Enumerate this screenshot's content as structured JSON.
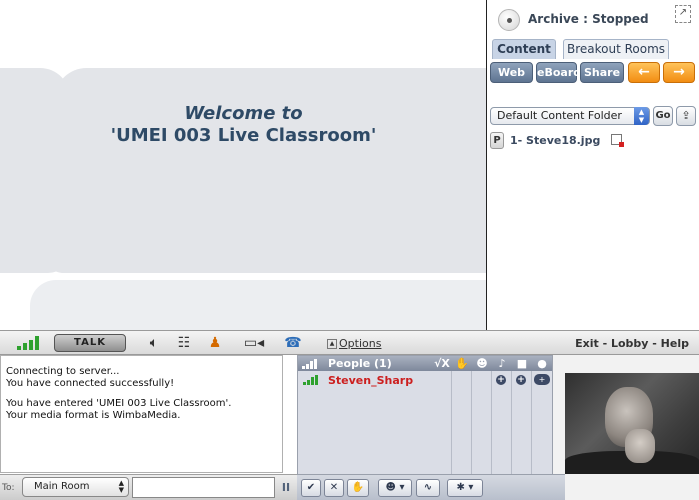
{
  "stage": {
    "welcome_line1": "Welcome to",
    "welcome_line2": "'UMEI 003 Live Classroom'"
  },
  "right_panel": {
    "archive_status": "Archive : Stopped",
    "tabs": [
      {
        "label": "Content",
        "active": true
      },
      {
        "label": "Breakout Rooms",
        "active": false
      }
    ],
    "buttons": {
      "web": "Web",
      "eboard": "eBoard",
      "share": "Share",
      "prev": "←",
      "next": "→"
    },
    "folder": {
      "selected": "Default Content Folder",
      "go_label": "Go",
      "upload": "⇪"
    },
    "files": [
      {
        "badge": "P",
        "name": "1- Steve18.jpg"
      }
    ]
  },
  "toolbar": {
    "talk_label": "TALK",
    "options_label": "Options",
    "nav": "Exit - Lobby - Help"
  },
  "chat": {
    "messages": [
      "Connecting to server...",
      "You have connected successfully!",
      "",
      "You have entered 'UMEI 003 Live Classroom'.",
      "Your media format is WimbaMedia."
    ],
    "to_label": "To:",
    "room_selected": "Main Room",
    "input_value": "",
    "pause_glyph": "II"
  },
  "people": {
    "title": "People (1)",
    "header_icons": {
      "check_cross": "√X",
      "hand": "✋",
      "smile": "☻",
      "mic": "♪",
      "cam": "■",
      "chat": "●"
    },
    "members": [
      {
        "name": "Steven_Sharp",
        "color": "#cc1f1f"
      }
    ],
    "bar_buttons": {
      "check": "✔",
      "cross": "✕",
      "hand": "✋",
      "emote": "☻ ▾",
      "pulse": "∿",
      "gear": "✱ ▾"
    }
  },
  "colors": {
    "accent_orange": "#f28d12",
    "button_blue": "#5e7491",
    "signal_green": "#2ea12e",
    "name_red": "#cc1f1f"
  }
}
